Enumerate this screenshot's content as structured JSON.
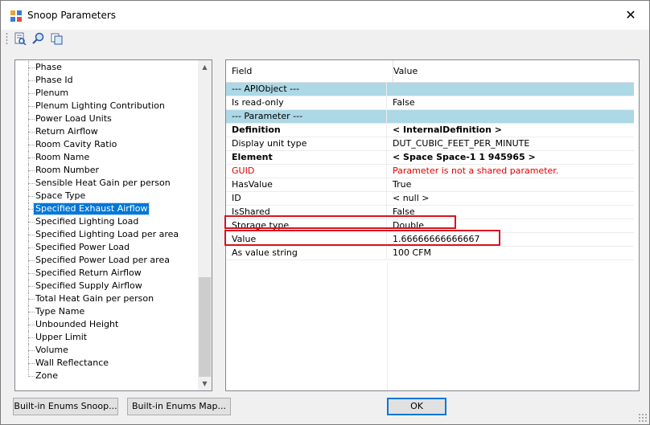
{
  "window": {
    "title": "Snoop Parameters",
    "close_glyph": "✕"
  },
  "toolbar": {
    "icons": [
      "snoop-icon",
      "find-icon",
      "copy-icon"
    ]
  },
  "tree": {
    "items": [
      {
        "label": "Phase"
      },
      {
        "label": "Phase Id"
      },
      {
        "label": "Plenum"
      },
      {
        "label": "Plenum Lighting Contribution"
      },
      {
        "label": "Power Load Units"
      },
      {
        "label": "Return Airflow"
      },
      {
        "label": "Room Cavity Ratio"
      },
      {
        "label": "Room Name"
      },
      {
        "label": "Room Number"
      },
      {
        "label": "Sensible Heat Gain per person"
      },
      {
        "label": "Space Type"
      },
      {
        "label": "Specified Exhaust Airflow",
        "selected": true
      },
      {
        "label": "Specified Lighting Load"
      },
      {
        "label": "Specified Lighting Load per area"
      },
      {
        "label": "Specified Power Load"
      },
      {
        "label": "Specified Power Load per area"
      },
      {
        "label": "Specified Return Airflow"
      },
      {
        "label": "Specified Supply Airflow"
      },
      {
        "label": "Total Heat Gain per person"
      },
      {
        "label": "Type Name"
      },
      {
        "label": "Unbounded Height"
      },
      {
        "label": "Upper Limit"
      },
      {
        "label": "Volume"
      },
      {
        "label": "Wall Reflectance"
      },
      {
        "label": "Zone"
      }
    ]
  },
  "grid": {
    "headers": {
      "field": "Field",
      "value": "Value"
    },
    "rows": [
      {
        "field": "--- APIObject ---",
        "value": "",
        "style": "section"
      },
      {
        "field": "Is read-only",
        "value": "False",
        "style": ""
      },
      {
        "field": "--- Parameter ---",
        "value": "",
        "style": "section"
      },
      {
        "field": "Definition",
        "value": "< InternalDefinition >",
        "style": "bold"
      },
      {
        "field": "Display unit type",
        "value": "DUT_CUBIC_FEET_PER_MINUTE",
        "style": ""
      },
      {
        "field": "Element",
        "value": "< Space  Space-1 1  945965 >",
        "style": "bold"
      },
      {
        "field": "GUID",
        "value": "Parameter is not a shared parameter.",
        "style": "error"
      },
      {
        "field": "HasValue",
        "value": "True",
        "style": ""
      },
      {
        "field": "ID",
        "value": "< null >",
        "style": ""
      },
      {
        "field": "IsShared",
        "value": "False",
        "style": ""
      },
      {
        "field": "Storage type",
        "value": "Double",
        "style": ""
      },
      {
        "field": "Value",
        "value": "1.66666666666667",
        "style": ""
      },
      {
        "field": "As value string",
        "value": "100 CFM",
        "style": ""
      }
    ],
    "section_color": "#add8e6",
    "error_color": "#e00000",
    "highlight_color": "#d8141f"
  },
  "buttons": {
    "builtin_snoop": "Built-in Enums Snoop...",
    "builtin_map": "Built-in Enums Map...",
    "ok": "OK"
  }
}
